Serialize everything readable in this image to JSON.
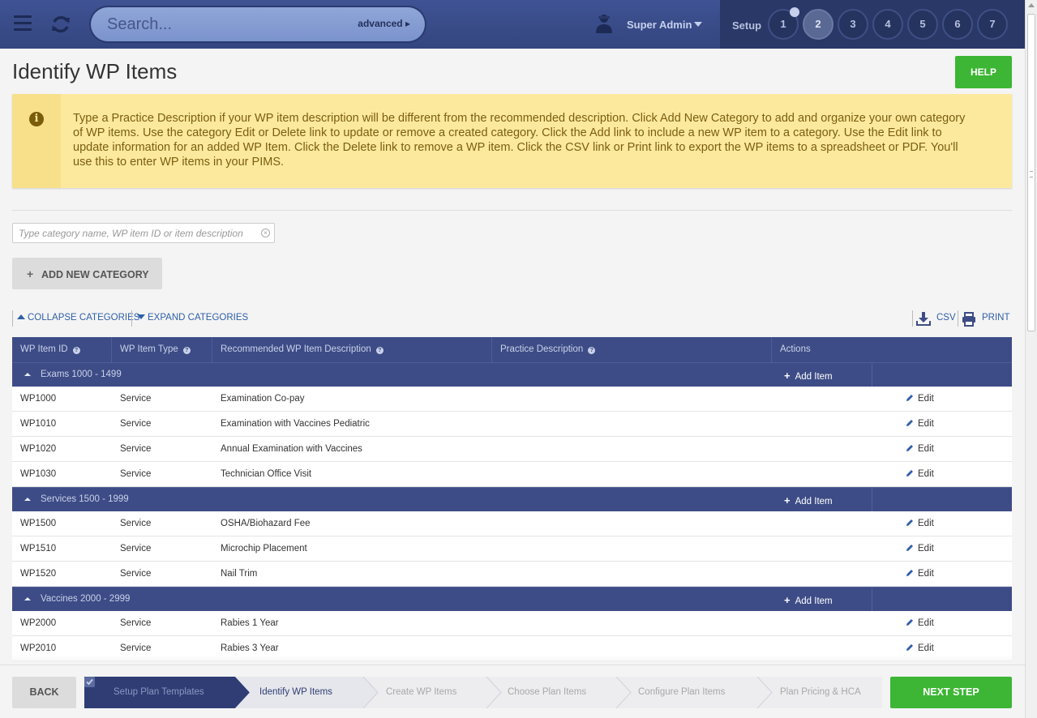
{
  "topbar": {
    "search_placeholder": "Search...",
    "advanced_label": "advanced",
    "user_name": "Super Admin",
    "setup_label": "Setup",
    "steps": [
      "1",
      "2",
      "3",
      "4",
      "5",
      "6",
      "7"
    ],
    "active_step": "2",
    "completed_steps": [
      "1"
    ]
  },
  "page": {
    "title": "Identify WP Items",
    "help_label": "HELP",
    "alert_text": "Type a Practice Description if your WP item description will be different from the recommended description. Click Add New Category to add and organize your own category of WP items. Use the category Edit or Delete link to update or remove a created category. Click the Add link to include a new WP item to a category. Use the Edit link to update information for an added WP Item. Click the Delete link to remove a WP item. Click the CSV link or Print link to export the WP items to a spreadsheet or PDF. You'll use this to enter WP items in your PIMS.",
    "filter_placeholder": "Type category name, WP item ID or item description",
    "add_category_label": "ADD NEW CATEGORY",
    "collapse_label": "COLLAPSE CATEGORIES",
    "expand_label": "EXPAND CATEGORIES",
    "csv_label": "CSV",
    "print_label": "PRINT"
  },
  "table": {
    "columns": [
      "WP Item ID",
      "WP Item Type",
      "Recommended WP Item Description",
      "Practice Description",
      "Actions"
    ],
    "add_item_label": "Add Item",
    "edit_label": "Edit",
    "categories": [
      {
        "name": "Exams 1000 - 1499",
        "items": [
          {
            "id": "WP1000",
            "type": "Service",
            "description": "Examination Co-pay"
          },
          {
            "id": "WP1010",
            "type": "Service",
            "description": "Examination with Vaccines Pediatric"
          },
          {
            "id": "WP1020",
            "type": "Service",
            "description": "Annual Examination with Vaccines"
          },
          {
            "id": "WP1030",
            "type": "Service",
            "description": "Technician Office Visit"
          }
        ]
      },
      {
        "name": "Services 1500 - 1999",
        "items": [
          {
            "id": "WP1500",
            "type": "Service",
            "description": "OSHA/Biohazard Fee"
          },
          {
            "id": "WP1510",
            "type": "Service",
            "description": "Microchip Placement"
          },
          {
            "id": "WP1520",
            "type": "Service",
            "description": "Nail Trim"
          }
        ]
      },
      {
        "name": "Vaccines 2000 - 2999",
        "items": [
          {
            "id": "WP2000",
            "type": "Service",
            "description": "Rabies 1 Year"
          },
          {
            "id": "WP2010",
            "type": "Service",
            "description": "Rabies 3 Year"
          }
        ]
      }
    ]
  },
  "footer": {
    "back_label": "BACK",
    "next_label": "NEXT STEP",
    "wizard_steps": [
      "Setup Plan Templates",
      "Identify WP Items",
      "Create WP Items",
      "Choose Plan Items",
      "Configure Plan Items",
      "Plan Pricing & HCA"
    ],
    "wizard_active_index": 1,
    "wizard_completed_index": 0
  },
  "colors": {
    "nav": "#3d4c86",
    "accent_green": "#3cb634",
    "alert_bg": "#fde99d",
    "link": "#2f5fa8"
  }
}
